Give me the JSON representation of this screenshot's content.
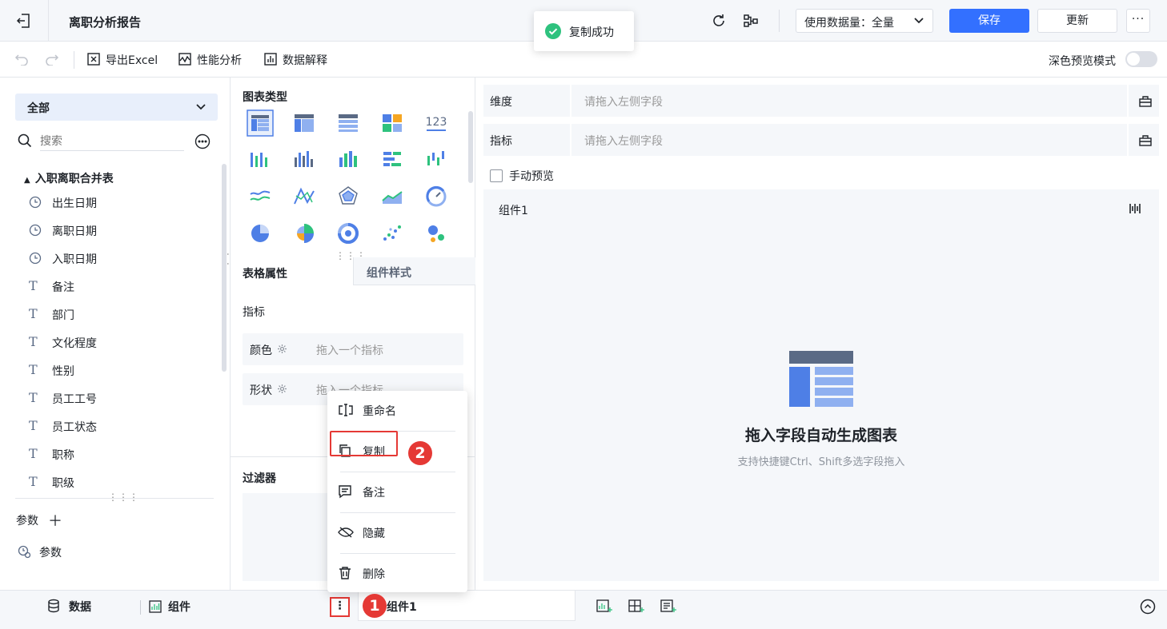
{
  "header": {
    "title": "离职分析报告",
    "data_volume_label": "使用数据量：全量",
    "save_label": "保存",
    "update_label": "更新",
    "more_label": "···"
  },
  "toast": {
    "text": "复制成功"
  },
  "toolbar": {
    "export_excel": "导出Excel",
    "performance": "性能分析",
    "data_explain": "数据解释",
    "dark_preview": "深色预览模式"
  },
  "left": {
    "scope": "全部",
    "search_placeholder": "搜索",
    "table_name": "入职离职合并表",
    "fields": [
      {
        "type": "date",
        "name": "出生日期"
      },
      {
        "type": "date",
        "name": "离职日期"
      },
      {
        "type": "date",
        "name": "入职日期"
      },
      {
        "type": "text",
        "name": "备注"
      },
      {
        "type": "text",
        "name": "部门"
      },
      {
        "type": "text",
        "name": "文化程度"
      },
      {
        "type": "text",
        "name": "性别"
      },
      {
        "type": "text",
        "name": "员工工号"
      },
      {
        "type": "text",
        "name": "员工状态"
      },
      {
        "type": "text",
        "name": "职称"
      },
      {
        "type": "text",
        "name": "职级"
      }
    ],
    "params_header": "参数",
    "params_item": "参数"
  },
  "middle": {
    "chart_type_title": "图表类型",
    "tab_table_attr": "表格属性",
    "tab_component_style": "组件样式",
    "metric_label": "指标",
    "color_label": "颜色",
    "color_placeholder": "拖入一个指标",
    "shape_label": "形状",
    "shape_placeholder": "拖入一个指标",
    "filter_title": "过滤器"
  },
  "right": {
    "dimension_label": "维度",
    "dimension_placeholder": "请拖入左侧字段",
    "metric_label": "指标",
    "metric_placeholder": "请拖入左侧字段",
    "manual_preview": "手动预览",
    "component_title": "组件1",
    "empty_title": "拖入字段自动生成图表",
    "empty_subtitle": "支持快捷键Ctrl、Shift多选字段拖入"
  },
  "context_menu": {
    "rename": "重命名",
    "copy": "复制",
    "note": "备注",
    "hide": "隐藏",
    "delete": "删除"
  },
  "bottom": {
    "data_tab": "数据",
    "component_tab": "组件",
    "component1_tab": "组件1"
  },
  "annotations": {
    "step1": "1",
    "step2": "2"
  },
  "colors": {
    "primary": "#3370ff",
    "highlight": "#e53935",
    "success": "#2ec27e"
  }
}
